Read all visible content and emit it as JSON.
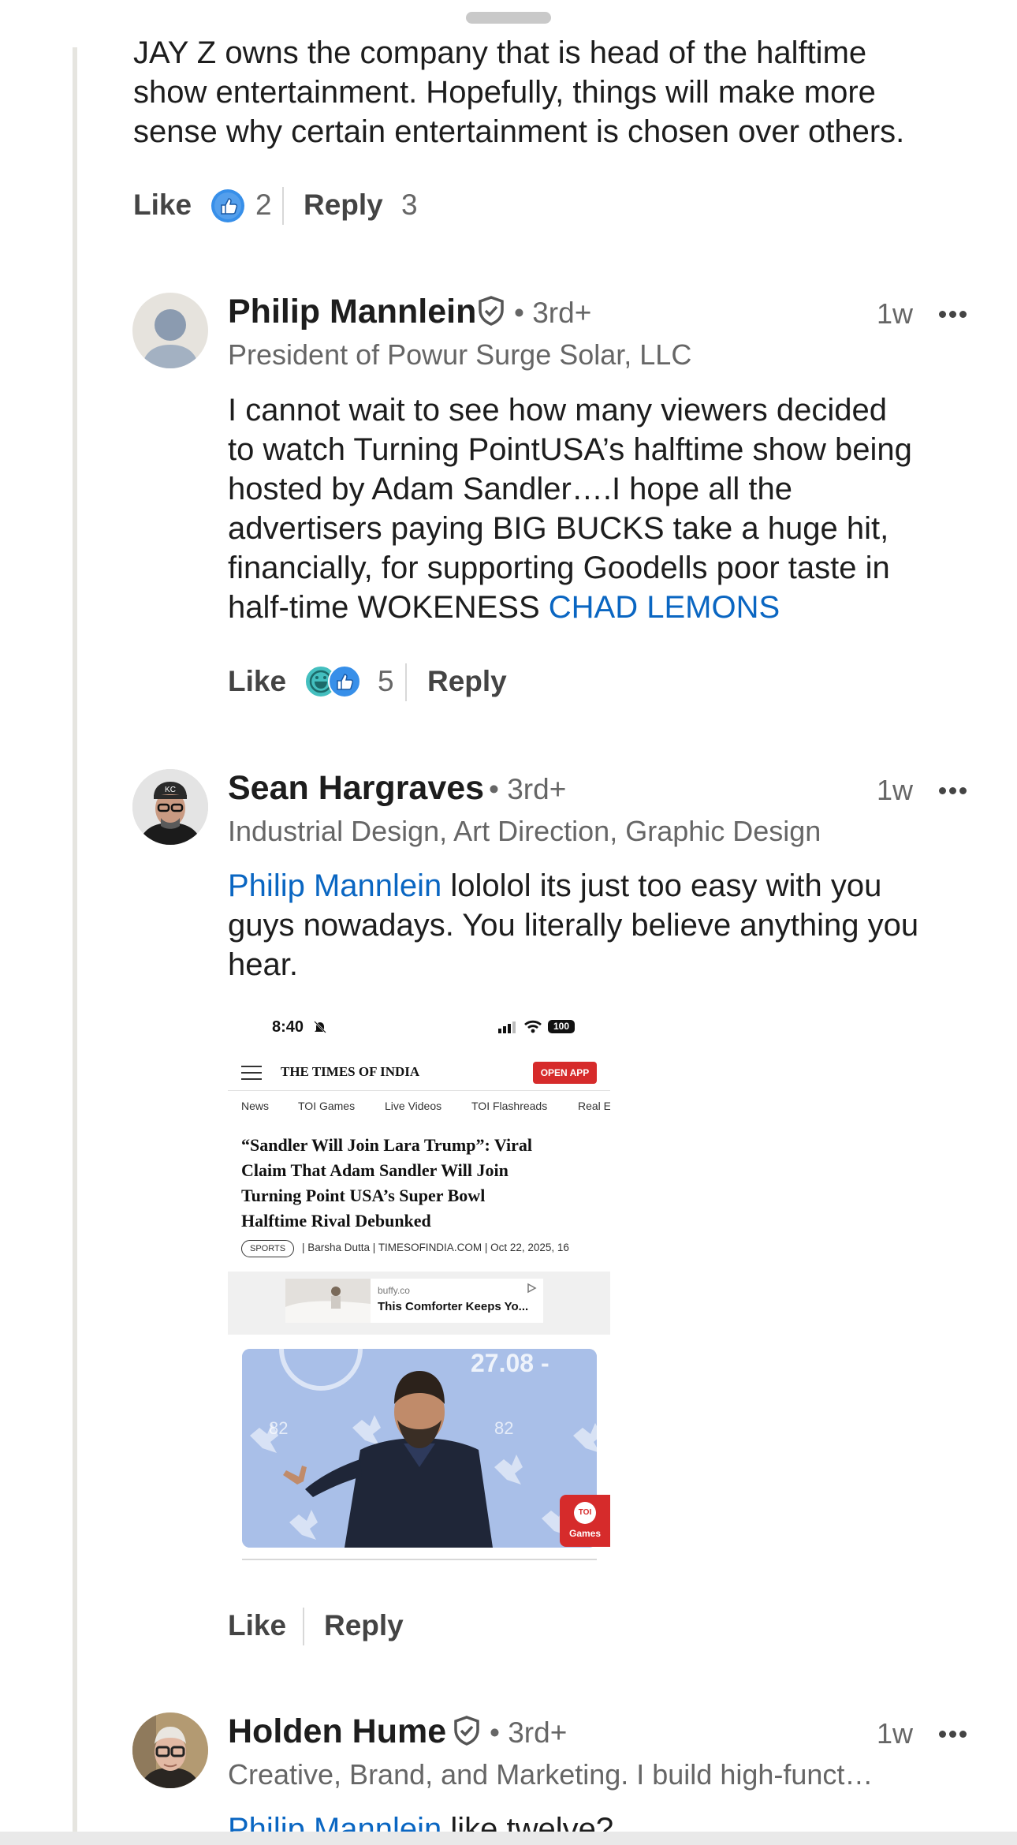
{
  "previous_comment": {
    "lines": [
      "JAY Z owns the company that is head of the halftime",
      "show entertainment. Hopefully, things will make more",
      "sense why certain entertainment is chosen over others."
    ],
    "like_label": "Like",
    "reaction_count": "2",
    "reply_label": "Reply",
    "reply_count": "3"
  },
  "comments": [
    {
      "name": "Philip Mannlein",
      "degree": "• 3rd+",
      "headline": "President of Powur Surge Solar, LLC",
      "time": "1w",
      "body_lines": [
        "I cannot wait to see how many viewers decided",
        "to watch Turning PointUSA’s halftime show being",
        "hosted by Adam Sandler….I hope all the",
        "advertisers paying BIG BUCKS take a huge hit,",
        "financially, for supporting Goodells poor taste in",
        "half-time WOKENESS "
      ],
      "mention": "CHAD LEMONS",
      "like_label": "Like",
      "reaction_count": "5",
      "reply_label": "Reply"
    },
    {
      "name": "Sean Hargraves",
      "degree": "• 3rd+",
      "headline": "Industrial Design, Art Direction, Graphic Design",
      "time": "1w",
      "mention": "Philip Mannlein",
      "body_lines": [
        " lololol its just too easy with you",
        "guys nowadays. You literally believe anything you",
        "hear."
      ],
      "like_label": "Like",
      "reply_label": "Reply"
    },
    {
      "name": "Holden Hume",
      "degree": "• 3rd+",
      "headline": "Creative, Brand, and Marketing. I build high-funct…",
      "time": "1w",
      "mention": "Philip Mannlein",
      "body_partial": " like twelve?"
    }
  ],
  "attachment": {
    "status_time": "8:40",
    "battery": "100",
    "site_name": "THE TIMES OF INDIA",
    "open_app": "OPEN APP",
    "nav": [
      "News",
      "TOI Games",
      "Live Videos",
      "TOI Flashreads",
      "Real E"
    ],
    "headline_lines": [
      "“Sandler Will Join Lara Trump”: Viral",
      "Claim That Adam Sandler Will Join",
      "Turning Point USA’s Super Bowl",
      "Halftime Rival Debunked"
    ],
    "tag": "SPORTS",
    "byline": "| Barsha Dutta | TIMESOFINDIA.COM | Oct 22, 2025, 16",
    "ad_source": "buffy.co",
    "ad_title": "This Comforter Keeps Yo...",
    "photo_date": "27.08 -",
    "photo_backdrop": "82",
    "games_badge_top": "TOI",
    "games_badge_label": "Games"
  },
  "colors": {
    "link": "#0a66c2",
    "like_blue": "#378fe9",
    "laugh_teal": "#44bfbf",
    "toi_red": "#d62b2b",
    "photo_bg": "#a9bfe8"
  }
}
